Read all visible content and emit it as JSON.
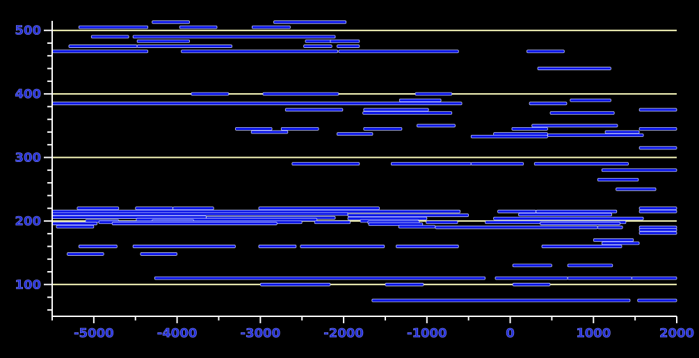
{
  "chart_data": {
    "type": "bar",
    "orientation": "horizontal-range",
    "title": "",
    "xlabel": "",
    "ylabel": "",
    "xlim": [
      -5500,
      2000
    ],
    "ylim": [
      50,
      515
    ],
    "x_ticks": [
      -5000,
      -4000,
      -3000,
      -2000,
      -1000,
      0,
      1000,
      2000
    ],
    "x_tick_labels": [
      "-5000",
      "-4000",
      "-3000",
      "-2000",
      "-1000",
      "0",
      "1000",
      "2000"
    ],
    "y_ticks": [
      100,
      200,
      300,
      400,
      500
    ],
    "y_tick_labels": [
      "100",
      "200",
      "300",
      "400",
      "500"
    ],
    "grid": "horizontal lines at y ticks",
    "legend": "none",
    "colors": {
      "background": "#000000",
      "bar_fill": "#0a14e6",
      "bar_edge": "#c8d0ff",
      "gridline": "#ffffc0",
      "axis": "#ffffff",
      "tick_label": "#2430d8"
    },
    "series": [
      {
        "intervals": [
          [
            -4300,
            -3850,
            513
          ],
          [
            -2840,
            -1970,
            513
          ],
          [
            -5180,
            -4350,
            505
          ],
          [
            -3970,
            -3520,
            505
          ],
          [
            -3100,
            -2640,
            505
          ],
          [
            -5030,
            -4580,
            490
          ],
          [
            -4530,
            -2100,
            490
          ],
          [
            -4480,
            -3850,
            483
          ],
          [
            -2460,
            -2140,
            483
          ],
          [
            -2160,
            -1810,
            483
          ],
          [
            -5300,
            -4480,
            475
          ],
          [
            -4480,
            -3340,
            475
          ],
          [
            -2480,
            -2140,
            475
          ],
          [
            -2080,
            -1810,
            475
          ],
          [
            -5500,
            -4350,
            467
          ],
          [
            -3950,
            -2070,
            467
          ],
          [
            -2060,
            -620,
            467
          ],
          [
            200,
            650,
            467
          ],
          [
            330,
            1210,
            440
          ],
          [
            -3830,
            -3380,
            400
          ],
          [
            -2970,
            -2060,
            400
          ],
          [
            -1140,
            -700,
            400
          ],
          [
            -1330,
            -830,
            390
          ],
          [
            720,
            1210,
            390
          ],
          [
            -5500,
            -580,
            385
          ],
          [
            230,
            680,
            385
          ],
          [
            -2700,
            -2010,
            375
          ],
          [
            -1760,
            -980,
            375
          ],
          [
            1550,
            2000,
            375
          ],
          [
            -1770,
            -700,
            370
          ],
          [
            480,
            1250,
            370
          ],
          [
            -1120,
            -660,
            350
          ],
          [
            260,
            1290,
            350
          ],
          [
            -3300,
            -2860,
            345
          ],
          [
            -2750,
            -2300,
            345
          ],
          [
            -1760,
            -1300,
            345
          ],
          [
            20,
            450,
            345
          ],
          [
            1550,
            2000,
            345
          ],
          [
            -3110,
            -2670,
            340
          ],
          [
            1140,
            1550,
            340
          ],
          [
            -2080,
            -1650,
            337
          ],
          [
            -200,
            450,
            337
          ],
          [
            450,
            1600,
            335
          ],
          [
            -470,
            450,
            333
          ],
          [
            1550,
            2000,
            315
          ],
          [
            -2620,
            -1810,
            290
          ],
          [
            -1430,
            -470,
            290
          ],
          [
            -470,
            160,
            290
          ],
          [
            290,
            1420,
            290
          ],
          [
            1100,
            2000,
            280
          ],
          [
            1050,
            1540,
            265
          ],
          [
            1270,
            1750,
            250
          ],
          [
            -5200,
            -4700,
            220
          ],
          [
            -4500,
            -4050,
            220
          ],
          [
            -4050,
            -3560,
            220
          ],
          [
            -3020,
            -1570,
            220
          ],
          [
            1550,
            2000,
            220
          ],
          [
            -5500,
            -600,
            215
          ],
          [
            -150,
            310,
            215
          ],
          [
            310,
            1280,
            215
          ],
          [
            1550,
            2000,
            215
          ],
          [
            -5500,
            -1950,
            211
          ],
          [
            -1950,
            -500,
            209
          ],
          [
            100,
            1220,
            210
          ],
          [
            -5500,
            -3650,
            206
          ],
          [
            -3650,
            -2100,
            205
          ],
          [
            -1950,
            -1000,
            204
          ],
          [
            -200,
            1600,
            204
          ],
          [
            -4490,
            -2320,
            202
          ],
          [
            -5100,
            -4700,
            200
          ],
          [
            -4300,
            -3800,
            200
          ],
          [
            -1800,
            -1100,
            200
          ],
          [
            -4940,
            -2500,
            198
          ],
          [
            -2350,
            -1920,
            198
          ],
          [
            -1710,
            -1090,
            198
          ],
          [
            -1010,
            -630,
            198
          ],
          [
            -300,
            1390,
            198
          ],
          [
            -5500,
            -4960,
            196
          ],
          [
            -4780,
            -2800,
            196
          ],
          [
            -1700,
            -1050,
            195
          ],
          [
            360,
            1320,
            196
          ],
          [
            -5450,
            -5000,
            191
          ],
          [
            -1340,
            -900,
            191
          ],
          [
            -900,
            1050,
            190
          ],
          [
            1050,
            1350,
            190
          ],
          [
            1550,
            2000,
            190
          ],
          [
            1550,
            2000,
            186
          ],
          [
            1550,
            2000,
            181
          ],
          [
            1000,
            1480,
            170
          ],
          [
            1100,
            1550,
            165
          ],
          [
            -5180,
            -4720,
            160
          ],
          [
            -4530,
            -3300,
            160
          ],
          [
            -3020,
            -2570,
            160
          ],
          [
            -2520,
            -1510,
            160
          ],
          [
            -1370,
            -620,
            160
          ],
          [
            380,
            1340,
            160
          ],
          [
            -5320,
            -4880,
            148
          ],
          [
            -4440,
            -4000,
            148
          ],
          [
            30,
            500,
            130
          ],
          [
            690,
            1230,
            130
          ],
          [
            -4270,
            -300,
            110
          ],
          [
            -180,
            690,
            110
          ],
          [
            690,
            1460,
            110
          ],
          [
            1460,
            2000,
            110
          ],
          [
            -3000,
            -2160,
            100
          ],
          [
            -1500,
            -1040,
            100
          ],
          [
            30,
            480,
            100
          ],
          [
            -1660,
            1440,
            75
          ],
          [
            1530,
            2000,
            75
          ]
        ]
      }
    ]
  }
}
